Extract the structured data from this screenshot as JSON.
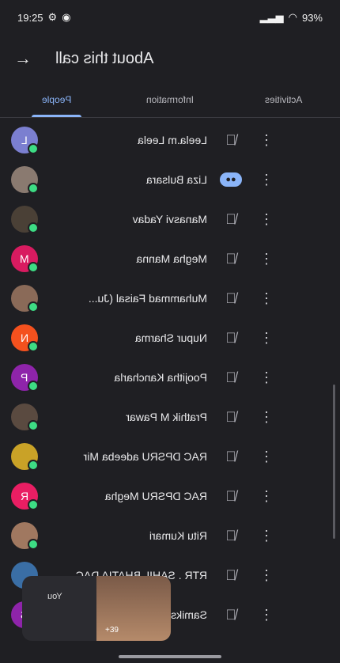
{
  "status": {
    "time": "19:25",
    "battery": "93%"
  },
  "header": {
    "title": "About this call",
    "back_icon": "arrow-back-icon"
  },
  "tabs": [
    {
      "label": "People",
      "active": true
    },
    {
      "label": "Information",
      "active": false
    },
    {
      "label": "Activities",
      "active": false
    }
  ],
  "people": [
    {
      "name": "Leela.m Leela",
      "initial": "L",
      "color": "#7b7fd0",
      "state": "muted"
    },
    {
      "name": "Liza Bulsara",
      "initial": "",
      "color": "#8a7a70",
      "state": "talking"
    },
    {
      "name": "Manasvi Yadav",
      "initial": "",
      "color": "#4a4036",
      "state": "muted"
    },
    {
      "name": "Megha Manna",
      "initial": "M",
      "color": "#d81b60",
      "state": "muted"
    },
    {
      "name": "Muhammad Faisal (Ju...",
      "initial": "",
      "color": "#8a6a58",
      "state": "muted"
    },
    {
      "name": "Nupur Sharma",
      "initial": "N",
      "color": "#f4511e",
      "state": "muted"
    },
    {
      "name": "Poojitha Kancharla",
      "initial": "P",
      "color": "#8e24aa",
      "state": "muted"
    },
    {
      "name": "Prathik M Pawar",
      "initial": "",
      "color": "#5a4a40",
      "state": "muted"
    },
    {
      "name": "RAC DPSRU adeeba Mir",
      "initial": "",
      "color": "#c9a227",
      "state": "muted"
    },
    {
      "name": "RAC DPSRU Megha",
      "initial": "R",
      "color": "#e91e63",
      "state": "muted"
    },
    {
      "name": "Ritu Kumari",
      "initial": "",
      "color": "#a07860",
      "state": "muted"
    },
    {
      "name": "RTR . SAHIL BHATIA DAC",
      "initial": "",
      "color": "#3a6ea5",
      "state": "muted"
    },
    {
      "name": "Samiksha Dhing...",
      "initial": "S",
      "color": "#8e24aa",
      "state": "muted"
    }
  ],
  "selfview": {
    "label": "You",
    "count": "+39"
  }
}
